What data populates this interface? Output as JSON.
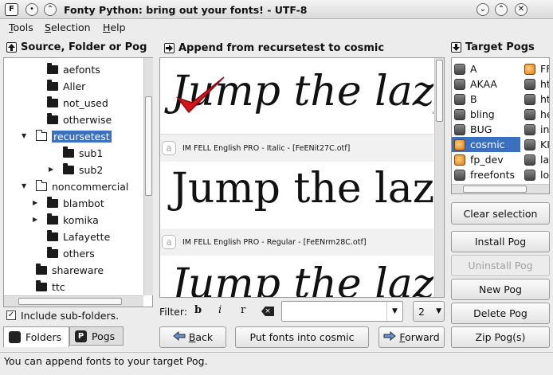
{
  "window": {
    "title": "Fonty Python: bring out your fonts!  -  UTF-8"
  },
  "menu": [
    "Tools",
    "Selection",
    "Help"
  ],
  "left_panel": {
    "title": "Source, Folder or Pog",
    "tree": [
      {
        "label": "aefonts",
        "type": "folder",
        "expander": ""
      },
      {
        "label": "Aller",
        "type": "folder",
        "expander": ""
      },
      {
        "label": "not_used",
        "type": "folder",
        "expander": ""
      },
      {
        "label": "otherwise",
        "type": "folder",
        "expander": ""
      },
      {
        "label": "recursetest",
        "type": "open",
        "expander": "▼",
        "selected": true
      },
      {
        "label": "sub1",
        "type": "folder",
        "expander": ""
      },
      {
        "label": "sub2",
        "type": "folder",
        "expander": "▶"
      },
      {
        "label": "noncommercial",
        "type": "open",
        "expander": "▼"
      },
      {
        "label": "blambot",
        "type": "folder",
        "expander": "▶"
      },
      {
        "label": "komika",
        "type": "folder",
        "expander": "▶"
      },
      {
        "label": "Lafayette",
        "type": "folder",
        "expander": ""
      },
      {
        "label": "others",
        "type": "folder",
        "expander": ""
      },
      {
        "label": "shareware",
        "type": "folder",
        "expander": ""
      },
      {
        "label": "ttc",
        "type": "folder",
        "expander": ""
      }
    ],
    "include_subfolders": "Include sub-folders.",
    "tabs": [
      "Folders",
      "Pogs"
    ]
  },
  "center_panel": {
    "title": "Append from recursetest to cosmic",
    "fonts": [
      {
        "sample": "Jump the lazy",
        "info": "IM FELL English PRO - Italic - [FeENit27C.otf]",
        "checked": true
      },
      {
        "sample": "Jump the laz",
        "info": "IM FELL English PRO - Regular - [FeENrm28C.otf]",
        "checked": false
      },
      {
        "sample": "Jump the lazy",
        "info": "",
        "checked": false
      }
    ],
    "filter_label": "Filter:",
    "filter_value": "",
    "page_value": "2",
    "buttons": {
      "back": "Back",
      "put": "Put fonts into cosmic",
      "forward": "Forward"
    }
  },
  "right_panel": {
    "title": "Target Pogs",
    "pogs_col1": [
      {
        "label": "A",
        "icon": "grey"
      },
      {
        "label": "AKAA",
        "icon": "grey"
      },
      {
        "label": "B",
        "icon": "grey"
      },
      {
        "label": "bling",
        "icon": "grey"
      },
      {
        "label": "BUG",
        "icon": "grey"
      },
      {
        "label": "cosmic",
        "icon": "orange",
        "selected": true
      },
      {
        "label": "fp_dev",
        "icon": "orange"
      },
      {
        "label": "freefonts",
        "icon": "grey"
      }
    ],
    "pogs_col2": [
      {
        "label": "FF",
        "icon": "orange"
      },
      {
        "label": "ht",
        "icon": "grey"
      },
      {
        "label": "ht",
        "icon": "grey"
      },
      {
        "label": "he",
        "icon": "grey"
      },
      {
        "label": "in",
        "icon": "grey"
      },
      {
        "label": "KI",
        "icon": "grey"
      },
      {
        "label": "la",
        "icon": "grey"
      },
      {
        "label": "lo",
        "icon": "grey"
      }
    ],
    "buttons": {
      "clear": "Clear selection",
      "install": "Install Pog",
      "uninstall": "Uninstall Pog",
      "new": "New Pog",
      "delete": "Delete Pog",
      "zip": "Zip Pog(s)"
    }
  },
  "status_bar": "You can append fonts to your target Pog."
}
